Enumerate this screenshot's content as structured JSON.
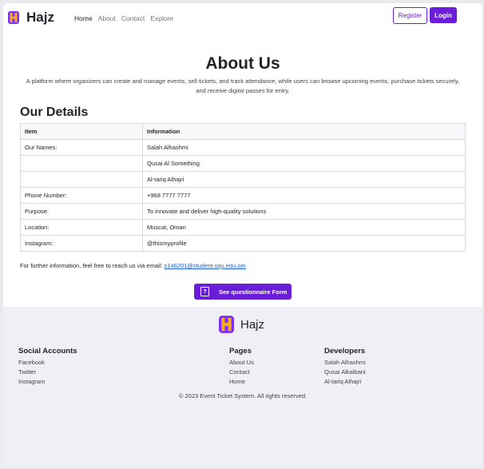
{
  "nav": {
    "brand": "Hajz",
    "links": [
      "Home",
      "About",
      "Contact",
      "Explore"
    ],
    "register_label": "Register",
    "login_label": "Login"
  },
  "about": {
    "title": "About Us",
    "description": "A platform where organizers can create and manage events, sell tickets, and track attendance, while users can browse upcoming events, purchase tickets securely, and receive digital passes for entry."
  },
  "details": {
    "title": "Our Details",
    "headers": [
      "Item",
      "Information"
    ],
    "rows": [
      [
        "Our Names:",
        "Salah Alhashmi"
      ],
      [
        "",
        "Qusai Al Something"
      ],
      [
        "",
        "Al-tariq Alhajri"
      ],
      [
        "Phone Number:",
        "+968 7777 7777"
      ],
      [
        "Purpose:",
        "To innovate and deliver high-quality solutions"
      ],
      [
        "Location:",
        "Muscat, Oman"
      ],
      [
        "Instagram:",
        "@thismyprofile"
      ]
    ]
  },
  "contact": {
    "text": "For further information, feel free to reach us via email: ",
    "email": "s146201@student.squ.edu.om"
  },
  "form_button": {
    "label": "See questionnaire Form",
    "icon": "question-icon"
  },
  "footer": {
    "brand": "Hajz",
    "social": {
      "title": "Social Accounts",
      "items": [
        "Facebook",
        "Twitter",
        "Instagram"
      ]
    },
    "pages": {
      "title": "Pages",
      "items": [
        "About Us",
        "Contact",
        "Home"
      ]
    },
    "developers": {
      "title": "Developers",
      "items": [
        "Salah Alhashmi",
        "Qusai Alkalbani",
        "Al-tariq Alhajri"
      ]
    },
    "copyright": "© 2023 Event Ticket System. All rights reserved."
  },
  "colors": {
    "accent": "#6a1ed8",
    "logo_top": "#7b2ff7",
    "logo_bottom": "#f9a825"
  }
}
